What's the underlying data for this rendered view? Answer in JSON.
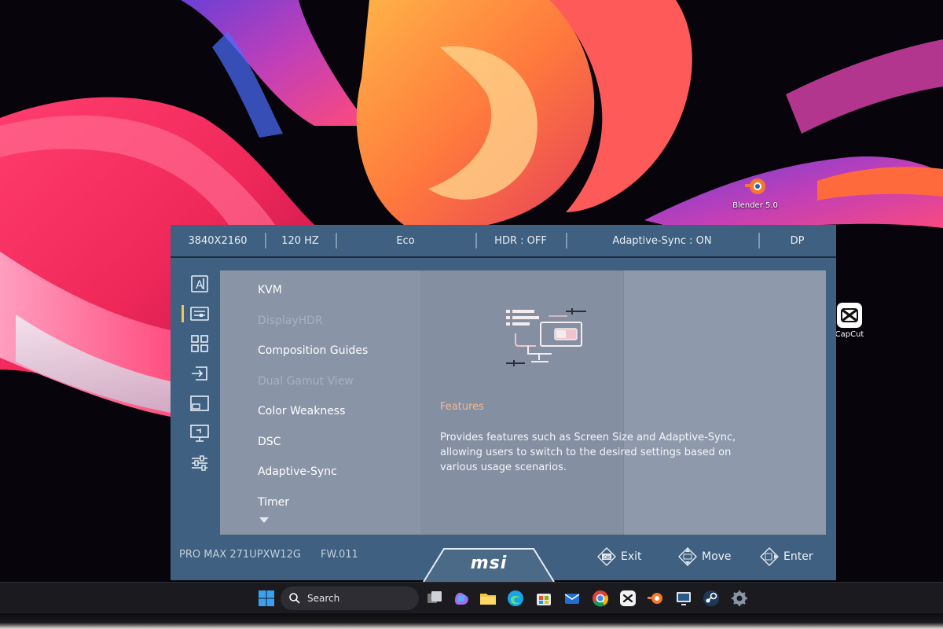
{
  "desktop": {
    "icons": [
      {
        "label": "Blender 5.0",
        "icon": "blender-icon"
      },
      {
        "label": "CapCut",
        "icon": "capcut-icon"
      }
    ]
  },
  "osd": {
    "status_bar": [
      "3840X2160",
      "120 HZ",
      "Eco",
      "HDR : OFF",
      "Adaptive-Sync : ON",
      "DP"
    ],
    "sidebar_icons": [
      "gaming-icon",
      "features-icon",
      "layout-icon",
      "input-source-icon",
      "pip-icon",
      "image-icon",
      "settings-icon"
    ],
    "active_sidebar_index": 1,
    "menu_items": [
      {
        "label": "KVM",
        "enabled": true
      },
      {
        "label": "DisplayHDR",
        "enabled": false
      },
      {
        "label": "Composition Guides",
        "enabled": true
      },
      {
        "label": "Dual Gamut View",
        "enabled": false
      },
      {
        "label": "Color Weakness",
        "enabled": true
      },
      {
        "label": "DSC",
        "enabled": true
      },
      {
        "label": "Adaptive-Sync",
        "enabled": true
      },
      {
        "label": "Timer",
        "enabled": true
      }
    ],
    "feature": {
      "title": "Features",
      "description": "Provides features such as Screen Size and Adaptive-Sync, allowing users to switch to the desired settings based on various usage scenarios."
    },
    "footer": {
      "model": "PRO MAX 271UPXW12G",
      "firmware": "FW.011",
      "brand": "msi",
      "hints": [
        {
          "label": "Exit",
          "icon": "joystick-press-icon"
        },
        {
          "label": "Move",
          "icon": "joystick-move-icon"
        },
        {
          "label": "Enter",
          "icon": "joystick-enter-icon"
        }
      ]
    }
  },
  "taskbar": {
    "search_label": "Search",
    "apps": [
      "task-view-icon",
      "copilot-icon",
      "file-explorer-icon",
      "edge-icon",
      "store-icon",
      "mail-icon",
      "chrome-icon",
      "capcut-icon",
      "blender-icon",
      "remote-icon",
      "steam-icon",
      "settings-icon"
    ]
  },
  "colors": {
    "osd_frame": "#3f6080",
    "osd_panel": "#8995a7",
    "accent_indicator": "#f0c45a",
    "feature_title": "#f0b896"
  }
}
